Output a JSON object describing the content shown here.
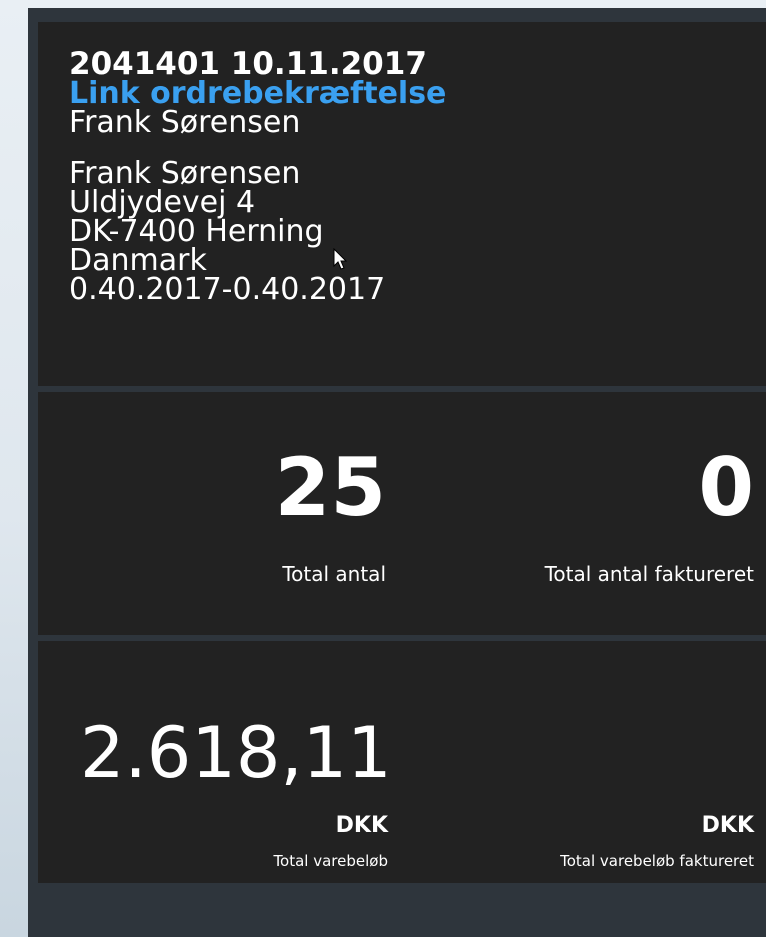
{
  "order": {
    "title": "2041401 10.11.2017",
    "link_label": "Link ordrebekræftelse",
    "customer": "Frank Sørensen",
    "address": {
      "name": "Frank Sørensen",
      "street": "Uldjydevej 4",
      "city": "DK-7400 Herning",
      "country": "Danmark",
      "period": "0.40.2017-0.40.2017"
    }
  },
  "quantities": {
    "total": {
      "value": "25",
      "label": "Total antal"
    },
    "invoiced": {
      "value": "0",
      "label": "Total antal faktureret"
    }
  },
  "amounts": {
    "total_value": "2.618,11",
    "total": {
      "currency": "DKK",
      "label": "Total varebeløb"
    },
    "invoiced": {
      "currency": "DKK",
      "label": "Total varebeløb faktureret"
    }
  },
  "colors": {
    "panel": "#222222",
    "frame": "#2e353c",
    "link": "#3aa0f0",
    "text": "#ffffff"
  },
  "icons": {
    "cursor": "mouse-pointer-icon"
  }
}
